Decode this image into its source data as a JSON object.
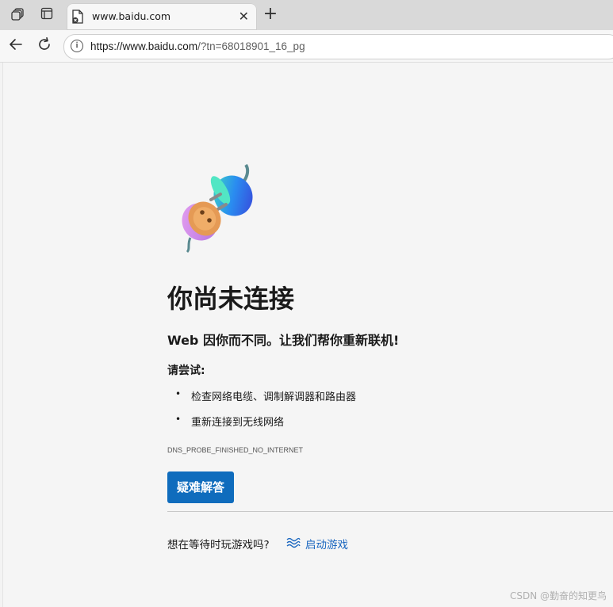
{
  "browser": {
    "tab": {
      "title": "www.baidu.com",
      "close_glyph": "✕"
    },
    "new_tab_glyph": "+",
    "address": {
      "host": "https://www.baidu.com",
      "path": "/?tn=68018901_16_pg"
    },
    "icons": {
      "workspaces": "workspaces-icon",
      "tab_actions": "tab-actions-icon",
      "back": "back-arrow-icon",
      "refresh": "refresh-icon",
      "site_info": "info-icon"
    }
  },
  "error_page": {
    "heading": "你尚未连接",
    "subheading": "Web 因你而不同。让我们帮你重新联机!",
    "try_label": "请尝试:",
    "suggestions": [
      "检查网络电缆、调制解调器和路由器",
      "重新连接到无线网络"
    ],
    "error_code": "DNS_PROBE_FINISHED_NO_INTERNET",
    "troubleshoot_button": "疑难解答",
    "game_prompt": "想在等待时玩游戏吗?",
    "game_link": "启动游戏"
  },
  "watermark": "CSDN @勤奋的知更鸟",
  "colors": {
    "primary_button": "#0f6cbd",
    "link": "#1b67c0",
    "page_background": "#f5f5f5",
    "titlebar": "#d9d9d9"
  }
}
